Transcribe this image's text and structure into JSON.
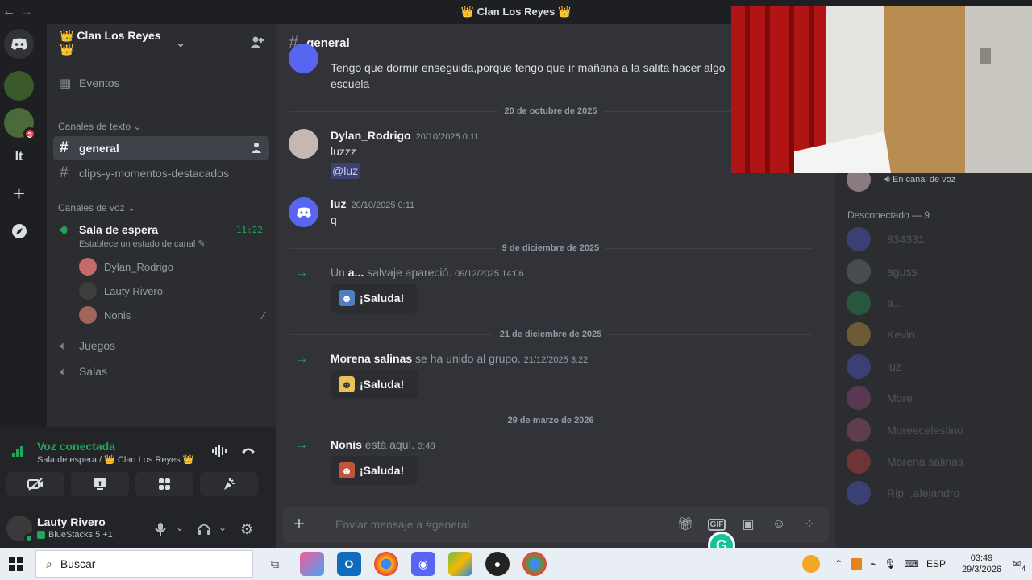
{
  "window": {
    "title": "👑 Clan Los Reyes 👑",
    "back_icon": "←",
    "forward_icon": "→"
  },
  "servers": {
    "dm_icon": "discord-logo-icon",
    "badge_count": "3",
    "server_initials": "lt",
    "add_icon": "+",
    "explore_icon": "compass-icon"
  },
  "guild": {
    "name": "👑 Clan Los Reyes 👑"
  },
  "channels": {
    "events_label": "Eventos",
    "text_category": "Canales de texto",
    "text_channels": [
      "general",
      "clips-y-momentos-destacados"
    ],
    "voice_category": "Canales de voz",
    "voice_channel_active": "Sala de espera",
    "voice_channel_time": "11:22",
    "voice_channel_status": "Establece un estado de canal",
    "voice_users": [
      "Dylan_Rodrigo",
      "Lauty Rivero",
      "Nonis"
    ],
    "other_voice_channels": [
      "Juegos",
      "Salas"
    ]
  },
  "voice_panel": {
    "status": "Voz conectada",
    "location": "Sala de espera / 👑 Clan Los Reyes 👑"
  },
  "user": {
    "name": "Lauty Rivero",
    "activity": "BlueStacks 5 +1"
  },
  "chat": {
    "channel_name": "general",
    "top_message": {
      "line1": "Tengo que dormir enseguida,porque tengo que ir mañana a la salita hacer algo",
      "line2": "escuela"
    },
    "dividers": [
      "20 de octubre de 2025",
      "9 de diciembre de 2025",
      "21 de diciembre de 2025",
      "29 de marzo de 2026"
    ],
    "messages": [
      {
        "author": "Dylan_Rodrigo",
        "time": "20/10/2025 0:11",
        "line1": "luzzz",
        "mention": "@luz"
      },
      {
        "author": "luz",
        "time": "20/10/2025 0:11",
        "line1": "q"
      }
    ],
    "system": [
      {
        "prefix": "Un",
        "name": "a...",
        "text": "salvaje apareció.",
        "time": "09/12/2025 14:06",
        "wave": "¡Saluda!"
      },
      {
        "prefix": "",
        "name": "Morena salinas",
        "text": "se ha unido al grupo.",
        "time": "21/12/2025 3:22",
        "wave": "¡Saluda!"
      },
      {
        "prefix": "",
        "name": "Nonis",
        "text": "está aquí.",
        "time": "3:48",
        "wave": "¡Saluda!"
      }
    ],
    "composer_placeholder": "Enviar mensaje a #general"
  },
  "members": {
    "online_status": "En canal de voz",
    "offline_header": "Desconectado — 9",
    "offline": [
      "834331",
      "aguss",
      "a...",
      "Kevin",
      "luz",
      "More",
      "Moreecelestino",
      "Morena salinas",
      "Rip_.alejandro"
    ]
  },
  "taskbar": {
    "search_placeholder": "Buscar",
    "language": "ESP",
    "time": "03:49",
    "date": "29/3/2026",
    "notification_count": "4"
  }
}
